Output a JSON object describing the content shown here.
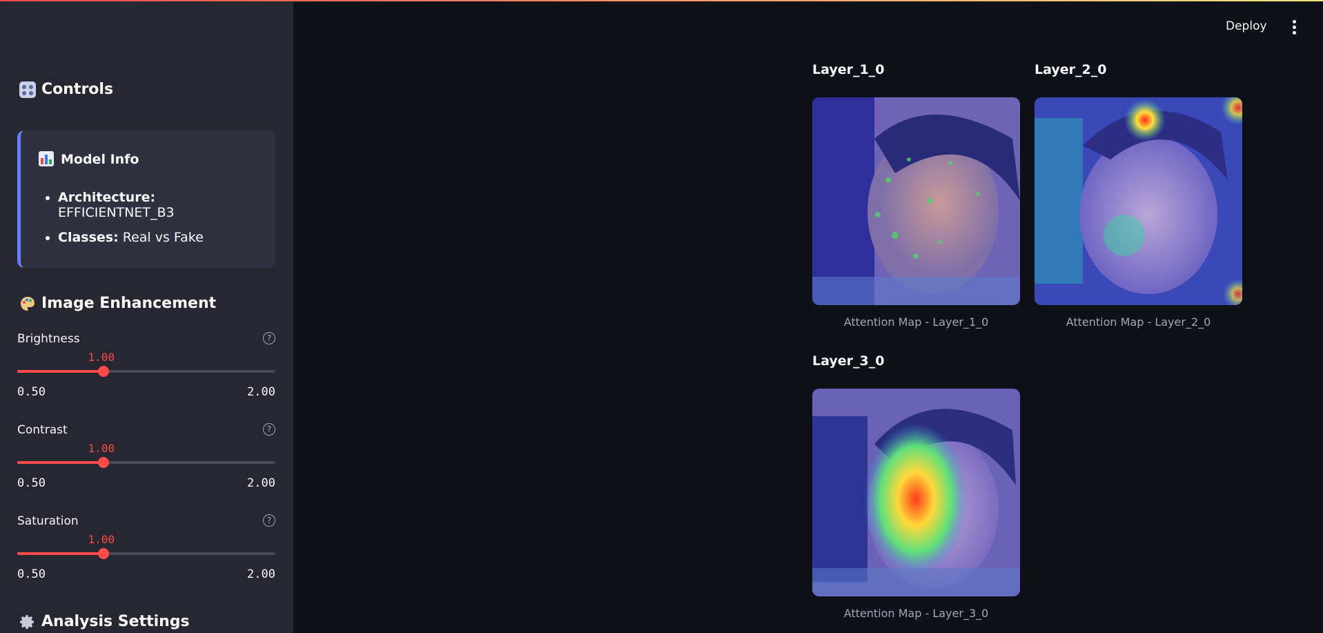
{
  "sidebar": {
    "controls_title": "Controls",
    "model_info": {
      "title": "Model Info",
      "architecture_label": "Architecture:",
      "architecture_value": "EFFICIENTNET_B3",
      "classes_label": "Classes:",
      "classes_value": "Real vs Fake"
    },
    "enhancement_title": "Image Enhancement",
    "sliders": [
      {
        "label": "Brightness",
        "value": "1.00",
        "min": "0.50",
        "max": "2.00",
        "fraction": 0.333
      },
      {
        "label": "Contrast",
        "value": "1.00",
        "min": "0.50",
        "max": "2.00",
        "fraction": 0.333
      },
      {
        "label": "Saturation",
        "value": "1.00",
        "min": "0.50",
        "max": "2.00",
        "fraction": 0.333
      }
    ],
    "help_glyph": "?",
    "analysis_title": "Analysis Settings"
  },
  "header": {
    "deploy_label": "Deploy"
  },
  "attention_maps": [
    {
      "title": "Layer_1_0",
      "caption": "Attention Map - Layer_1_0"
    },
    {
      "title": "Layer_2_0",
      "caption": "Attention Map - Layer_2_0"
    },
    {
      "title": "Layer_3_0",
      "caption": "Attention Map - Layer_3_0"
    }
  ],
  "colors": {
    "accent": "#ff4b4b",
    "sidebar_bg": "#262730",
    "main_bg": "#0e1117",
    "info_border": "#6b7cff"
  },
  "icons": {
    "controls": "control-knobs-icon",
    "model_info": "bar-chart-icon",
    "enhancement": "palette-icon",
    "analysis": "gear-icon",
    "menu": "kebab-menu-icon"
  }
}
